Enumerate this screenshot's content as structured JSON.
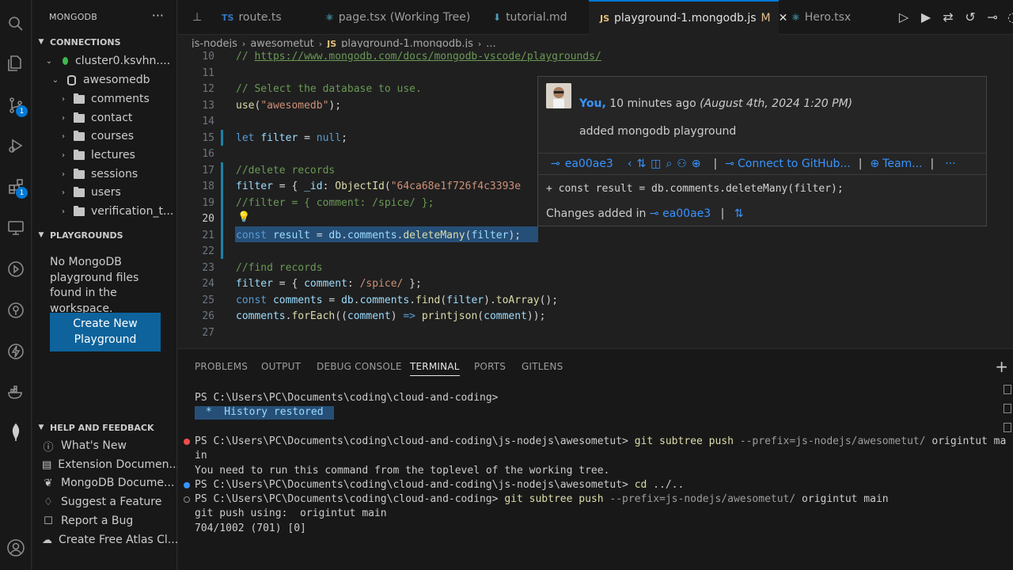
{
  "activity_bar": {
    "items": [
      {
        "name": "explorer-icon"
      },
      {
        "name": "search-icon"
      },
      {
        "name": "source-control-icon",
        "badge": "1"
      },
      {
        "name": "run-debug-icon"
      },
      {
        "name": "extensions-icon",
        "badge": "1"
      },
      {
        "name": "remote-explorer-icon"
      },
      {
        "name": "github-actions-icon"
      },
      {
        "name": "gitlens-icon"
      },
      {
        "name": "thunder-client-icon"
      },
      {
        "name": "docker-icon"
      },
      {
        "name": "mongodb-leaf-icon"
      },
      {
        "name": "accounts-icon"
      }
    ]
  },
  "sidebar": {
    "title": "MONGODB",
    "more": "···",
    "connections_header": "CONNECTIONS",
    "cluster": "cluster0.ksvhn....",
    "database": "awesomedb",
    "collections": [
      "comments",
      "contact",
      "courses",
      "lectures",
      "sessions",
      "users",
      "verification_t..."
    ],
    "playgrounds_header": "PLAYGROUNDS",
    "playgrounds_empty": "No MongoDB playground files found in the workspace.",
    "create_button": "Create New Playground",
    "help_header": "HELP AND FEEDBACK",
    "help_items": [
      {
        "icon": "info-icon",
        "label": "What's New"
      },
      {
        "icon": "book-icon",
        "label": "Extension Documen..."
      },
      {
        "icon": "leaf-icon",
        "label": "MongoDB Docume..."
      },
      {
        "icon": "lightbulb-icon",
        "label": "Suggest a Feature"
      },
      {
        "icon": "bug-icon",
        "label": "Report a Bug"
      },
      {
        "icon": "cloud-icon",
        "label": "Create Free Atlas Cl..."
      }
    ]
  },
  "tabs": [
    {
      "badge": "TS",
      "label": "route.ts"
    },
    {
      "badge": "",
      "label": "page.tsx (Working Tree)"
    },
    {
      "badge": "",
      "label": "tutorial.md"
    },
    {
      "badge": "JS",
      "label": "playground-1.mongodb.js",
      "modified": "M",
      "active": true
    },
    {
      "badge": "",
      "label": "Hero.tsx"
    }
  ],
  "breadcrumbs": [
    "js-nodejs",
    "awesometut",
    "playground-1.mongodb.js",
    "..."
  ],
  "editor": {
    "line_numbers": [
      "10",
      "11",
      "12",
      "13",
      "14",
      "15",
      "16",
      "17",
      "18",
      "19",
      "20",
      "21",
      "22",
      "23",
      "24",
      "25",
      "26",
      "27"
    ],
    "current_line": "20"
  },
  "hover": {
    "author": "You,",
    "time": " 10 minutes ago ",
    "date": "(August 4th, 2024 1:20 PM)",
    "message": "added mongodb playground",
    "commit": "ea00ae3",
    "connect": "Connect to GitHub...",
    "team": "Team...",
    "diff": "+ const result = db.comments.deleteMany(filter);",
    "changes_label": "Changes added in",
    "changes_commit": "ea00ae3"
  },
  "panel": {
    "tabs": [
      "PROBLEMS",
      "OUTPUT",
      "DEBUG CONSOLE",
      "TERMINAL",
      "PORTS",
      "GITLENS"
    ],
    "active_tab": "TERMINAL",
    "prompt1": "PS C:\\Users\\PC\\Documents\\coding\\cloud-and-coding>",
    "history": " *  History restored ",
    "prompt2": "PS C:\\Users\\PC\\Documents\\coding\\cloud-and-coding\\js-nodejs\\awesometut>",
    "cmd2_git": "git subtree push",
    "cmd2_args": " --prefix=js-nodejs/awesometut/",
    "cmd2_rest": " origintut ma",
    "cmd2_wrap": "in",
    "error_msg": "You need to run this command from the toplevel of the working tree.",
    "prompt3": "PS C:\\Users\\PC\\Documents\\coding\\cloud-and-coding\\js-nodejs\\awesometut>",
    "cmd3": "cd",
    "cmd3_args": " ../..",
    "prompt4": "PS C:\\Users\\PC\\Documents\\coding\\cloud-and-coding>",
    "cmd4_git": "git subtree push",
    "cmd4_args": " --prefix=js-nodejs/awesometut/",
    "cmd4_rest": " origintut main",
    "out1": "git push using:  origintut main",
    "out2": "704/1002 (701) [0]"
  }
}
